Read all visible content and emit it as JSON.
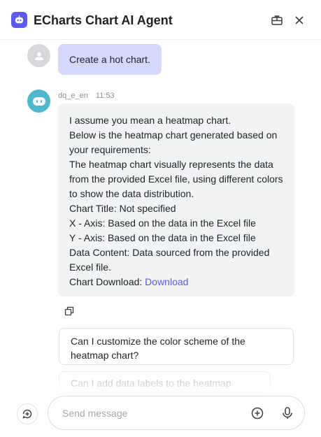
{
  "header": {
    "title": "ECharts Chart AI Agent",
    "logo_icon": "robot-logo-icon",
    "actions": [
      "toolbox-icon",
      "close-icon"
    ]
  },
  "conversation": {
    "user_message": "Create a hot chart.",
    "bot": {
      "name": "dq_e_en",
      "time": "11:53",
      "lines": [
        "I assume you mean a heatmap chart.",
        "Below is the heatmap chart generated based on your requirements:",
        "The heatmap chart visually represents the data from the provided Excel file, using different colors to show the data distribution.",
        "Chart Title: Not specified",
        "X - Axis: Based on the data in the Excel file",
        "Y - Axis: Based on the data in the Excel file",
        "Data Content: Data sourced from the provided Excel file."
      ],
      "download_prefix": "Chart Download: ",
      "download_link": "Download"
    }
  },
  "suggestions": [
    "Can I customize the color scheme of the heatmap chart?",
    "Can I add data labels to the heatmap chart?"
  ],
  "composer": {
    "placeholder": "Send message",
    "icons": [
      "new-chat-icon",
      "plus-circle-icon",
      "microphone-icon"
    ]
  },
  "colors": {
    "accent": "#5b5bf0",
    "user_bubble": "#d5d7fd",
    "bot_bubble": "#f2f3f5",
    "bot_avatar": "#4fb8cf"
  }
}
